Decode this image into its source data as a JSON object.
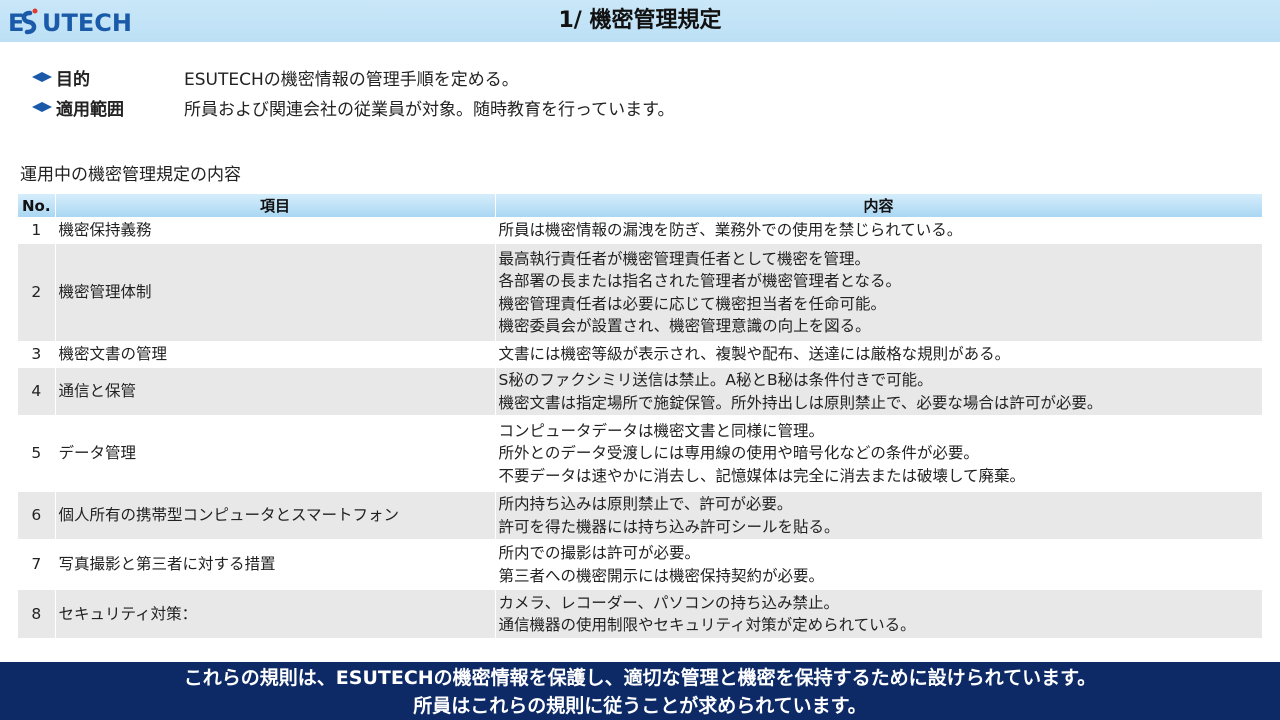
{
  "header": {
    "logo_text": "ESUTECH",
    "title": "1/ 機密管理規定"
  },
  "info": [
    {
      "label": "目的",
      "text": "ESUTECHの機密情報の管理手順を定める。",
      "icon": "diamond-bullet-icon"
    },
    {
      "label": "適用範囲",
      "text": "所員および関連会社の従業員が対象。随時教育を行っています。",
      "icon": "diamond-bullet-icon"
    }
  ],
  "section_title": "運用中の機密管理規定の内容",
  "table": {
    "headers": [
      "No.",
      "項目",
      "内容"
    ],
    "rows": [
      {
        "no": "1",
        "item": "機密保持義務",
        "lines": [
          "所員は機密情報の漏洩を防ぎ、業務外での使用を禁じられている。",
          "",
          "",
          ""
        ]
      },
      {
        "no": "2",
        "item": "機密管理体制",
        "lines": [
          "最高執行責任者が機密管理責任者として機密を管理。",
          "各部署の長または指名された管理者が機密管理者となる。",
          "機密管理責任者は必要に応じて機密担当者を任命可能。",
          "機密委員会が設置され、機密管理意識の向上を図る。"
        ]
      },
      {
        "no": "3",
        "item": "機密文書の管理",
        "lines": [
          "文書には機密等級が表示され、複製や配布、送達には厳格な規則がある。",
          "",
          "",
          ""
        ]
      },
      {
        "no": "4",
        "item": "通信と保管",
        "lines": [
          "S秘のファクシミリ送信は禁止。A秘とB秘は条件付きで可能。",
          "機密文書は指定場所で施錠保管。所外持出しは原則禁止で、必要な場合は許可が必要。",
          "",
          ""
        ]
      },
      {
        "no": "5",
        "item": "データ管理",
        "lines": [
          "コンピュータデータは機密文書と同様に管理。",
          "所外とのデータ受渡しには専用線の使用や暗号化などの条件が必要。",
          "不要データは速やかに消去し、記憶媒体は完全に消去または破壊して廃棄。",
          ""
        ]
      },
      {
        "no": "6",
        "item": "個人所有の携帯型コンピュータとスマートフォン",
        "lines": [
          "所内持ち込みは原則禁止で、許可が必要。",
          "許可を得た機器には持ち込み許可シールを貼る。",
          "",
          ""
        ]
      },
      {
        "no": "7",
        "item": "写真撮影と第三者に対する措置",
        "lines": [
          "所内での撮影は許可が必要。",
          "第三者への機密開示には機密保持契約が必要。",
          "",
          ""
        ]
      },
      {
        "no": "8",
        "item": "セキュリティ対策：",
        "lines": [
          "カメラ、レコーダー、パソコンの持ち込み禁止。",
          "通信機器の使用制限やセキュリティ対策が定められている。",
          "",
          ""
        ]
      }
    ]
  },
  "footer": {
    "line1": "これらの規則は、ESUTECHの機密情報を保護し、適切な管理と機密を保持するために設けられています。",
    "line2": "所員はこれらの規則に従うことが求められています。"
  },
  "colors": {
    "header_bg": "#c9e7f8",
    "footer_bg": "#0d2a66",
    "bullet": "#1a5aa8",
    "row_alt": "#e8e8e8"
  }
}
